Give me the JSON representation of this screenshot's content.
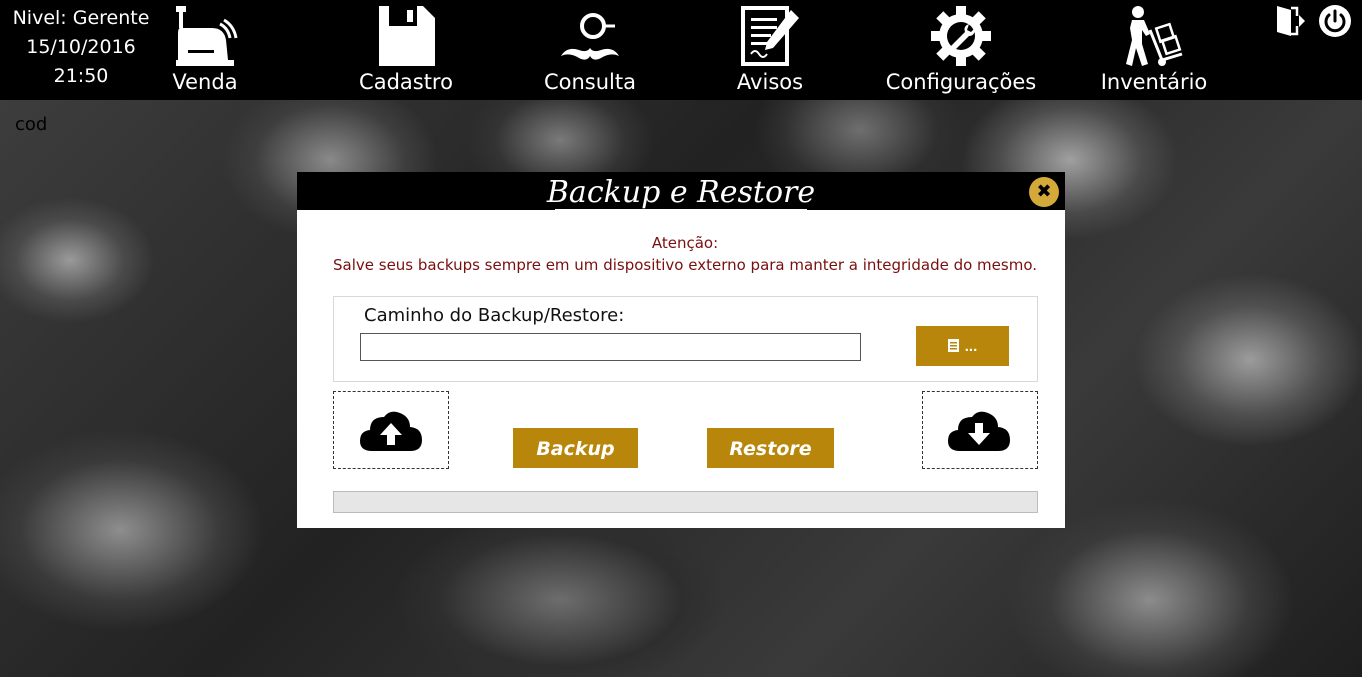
{
  "user": {
    "level": "Nivel: Gerente",
    "date": "15/10/2016",
    "time": "21:50"
  },
  "nav": [
    {
      "label": "Venda",
      "icon": "cash-register-icon"
    },
    {
      "label": "Cadastro",
      "icon": "floppy-disk-icon"
    },
    {
      "label": "Consulta",
      "icon": "detective-icon"
    },
    {
      "label": "Avisos",
      "icon": "notepad-icon"
    },
    {
      "label": "Configurações",
      "icon": "gear-wrench-icon"
    },
    {
      "label": "Inventário",
      "icon": "hand-truck-icon"
    }
  ],
  "top_right_icons": [
    "logout-door-icon",
    "power-icon"
  ],
  "field_label": "cod",
  "modal": {
    "title": "Backup e Restore",
    "close_icon": "close-icon",
    "notice_title": "Atenção:",
    "notice_text": "Salve seus backups sempre em um dispositivo externo para manter a integridade do mesmo.",
    "path_label": "Caminho do Backup/Restore:",
    "path_value": "",
    "browse_label": "...",
    "browse_icon": "document-icon",
    "upload_icon": "cloud-upload-icon",
    "download_icon": "cloud-download-icon",
    "backup_label": "Backup",
    "restore_label": "Restore",
    "progress": 0
  },
  "colors": {
    "accent": "#b8860b",
    "close_button": "#d4a93a",
    "notice_text": "#7a0f0f",
    "topbar": "#000000"
  }
}
